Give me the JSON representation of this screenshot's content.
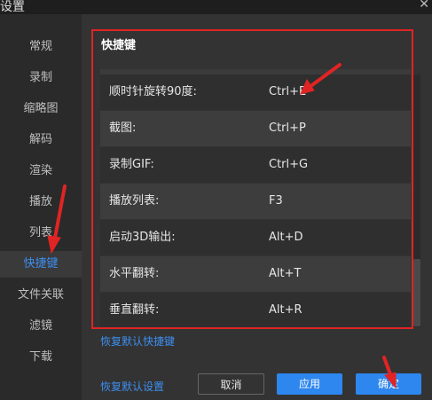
{
  "window": {
    "title": "设置",
    "close_icon": "close-icon"
  },
  "sidebar": {
    "items": [
      {
        "label": "常规",
        "active": false
      },
      {
        "label": "录制",
        "active": false
      },
      {
        "label": "缩略图",
        "active": false
      },
      {
        "label": "解码",
        "active": false
      },
      {
        "label": "渲染",
        "active": false
      },
      {
        "label": "播放",
        "active": false
      },
      {
        "label": "列表",
        "active": false
      },
      {
        "label": "快捷键",
        "active": true
      },
      {
        "label": "文件关联",
        "active": false
      },
      {
        "label": "滤镜",
        "active": false
      },
      {
        "label": "下载",
        "active": false
      }
    ]
  },
  "shortcuts": {
    "title": "快捷键",
    "rows": [
      {
        "name": "顺时针旋转90度:",
        "key": "Ctrl+E"
      },
      {
        "name": "截图:",
        "key": "Ctrl+P"
      },
      {
        "name": "录制GIF:",
        "key": "Ctrl+G"
      },
      {
        "name": "播放列表:",
        "key": "F3"
      },
      {
        "name": "启动3D输出:",
        "key": "Alt+D"
      },
      {
        "name": "水平翻转:",
        "key": "Alt+T"
      },
      {
        "name": "垂直翻转:",
        "key": "Alt+R"
      }
    ],
    "restore_shortcuts_link": "恢复默认快捷键"
  },
  "footer": {
    "restore_defaults_link": "恢复默认设置",
    "cancel_label": "取消",
    "apply_label": "应用",
    "ok_label": "确定"
  },
  "colors": {
    "accent": "#2e86ef",
    "highlight_box": "#e02424",
    "annotation_arrow": "#e02424"
  }
}
